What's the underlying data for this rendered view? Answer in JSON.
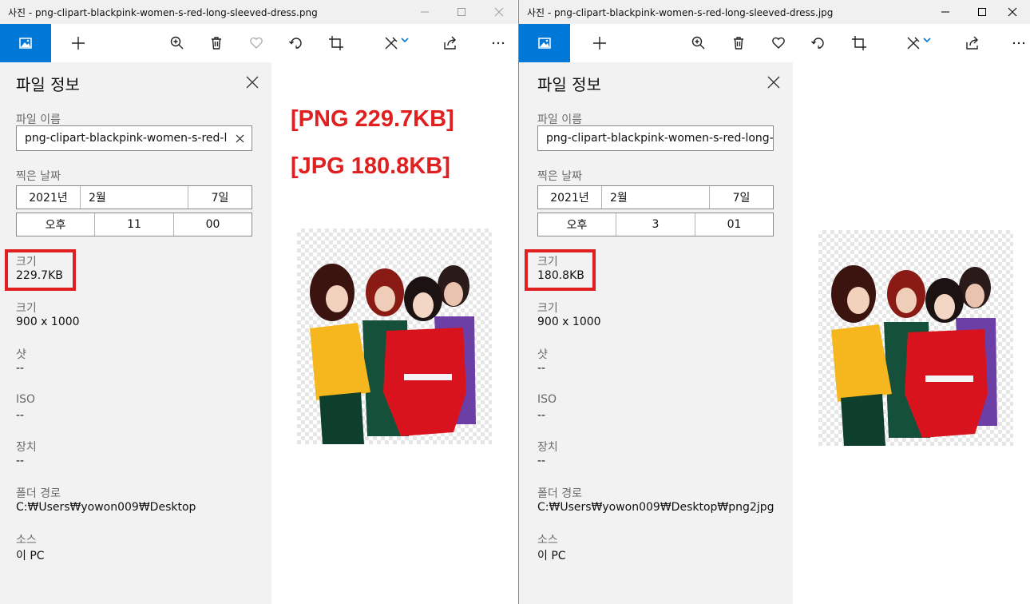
{
  "left": {
    "title": "사진 - png-clipart-blackpink-women-s-red-long-sleeved-dress.png",
    "panel_title": "파일 정보",
    "file_name_label": "파일 이름",
    "file_name_value": "png-clipart-blackpink-women-s-red-long-sleeved-dress.png",
    "date_label": "찍은 날짜",
    "date": {
      "year": "2021년",
      "month": "2월",
      "day": "7일"
    },
    "time": {
      "ampm": "오후",
      "hour": "11",
      "minute": "00"
    },
    "size_label": "크기",
    "size_value": "229.7KB",
    "dimensions_label": "크기",
    "dimensions_value": "900 x 1000",
    "shutter_label": "샷",
    "shutter_value": "--",
    "iso_label": "ISO",
    "iso_value": "--",
    "device_label": "장치",
    "device_value": "--",
    "folder_label": "폴더 경로",
    "folder_value": "C:₩Users₩yowon009₩Desktop",
    "source_label": "소스",
    "source_value": "이 PC",
    "annotations": [
      "[PNG 229.7KB]",
      "[JPG 180.8KB]"
    ]
  },
  "right": {
    "title": "사진 - png-clipart-blackpink-women-s-red-long-sleeved-dress.jpg",
    "panel_title": "파일 정보",
    "file_name_label": "파일 이름",
    "file_name_value": "png-clipart-blackpink-women-s-red-long-sleeved-dress.jpg",
    "date_label": "찍은 날짜",
    "date": {
      "year": "2021년",
      "month": "2월",
      "day": "7일"
    },
    "time": {
      "ampm": "오후",
      "hour": "3",
      "minute": "01"
    },
    "size_label": "크기",
    "size_value": "180.8KB",
    "dimensions_label": "크기",
    "dimensions_value": "900 x 1000",
    "shutter_label": "샷",
    "shutter_value": "--",
    "iso_label": "ISO",
    "iso_value": "--",
    "device_label": "장치",
    "device_value": "--",
    "folder_label": "폴더 경로",
    "folder_value": "C:₩Users₩yowon009₩Desktop₩png2jpg",
    "source_label": "소스",
    "source_value": "이 PC"
  },
  "icons": {
    "app": "photo-icon",
    "add": "plus-icon",
    "zoom": "zoom-in-icon",
    "delete": "trash-icon",
    "favorite": "heart-icon",
    "rotate": "rotate-icon",
    "crop": "crop-icon",
    "edit": "edit-create-icon",
    "share": "share-icon",
    "more": "more-icon"
  },
  "colors": {
    "accent": "#0078d7",
    "annotation_red": "#e02020",
    "panel_bg": "#f2f2f2"
  }
}
